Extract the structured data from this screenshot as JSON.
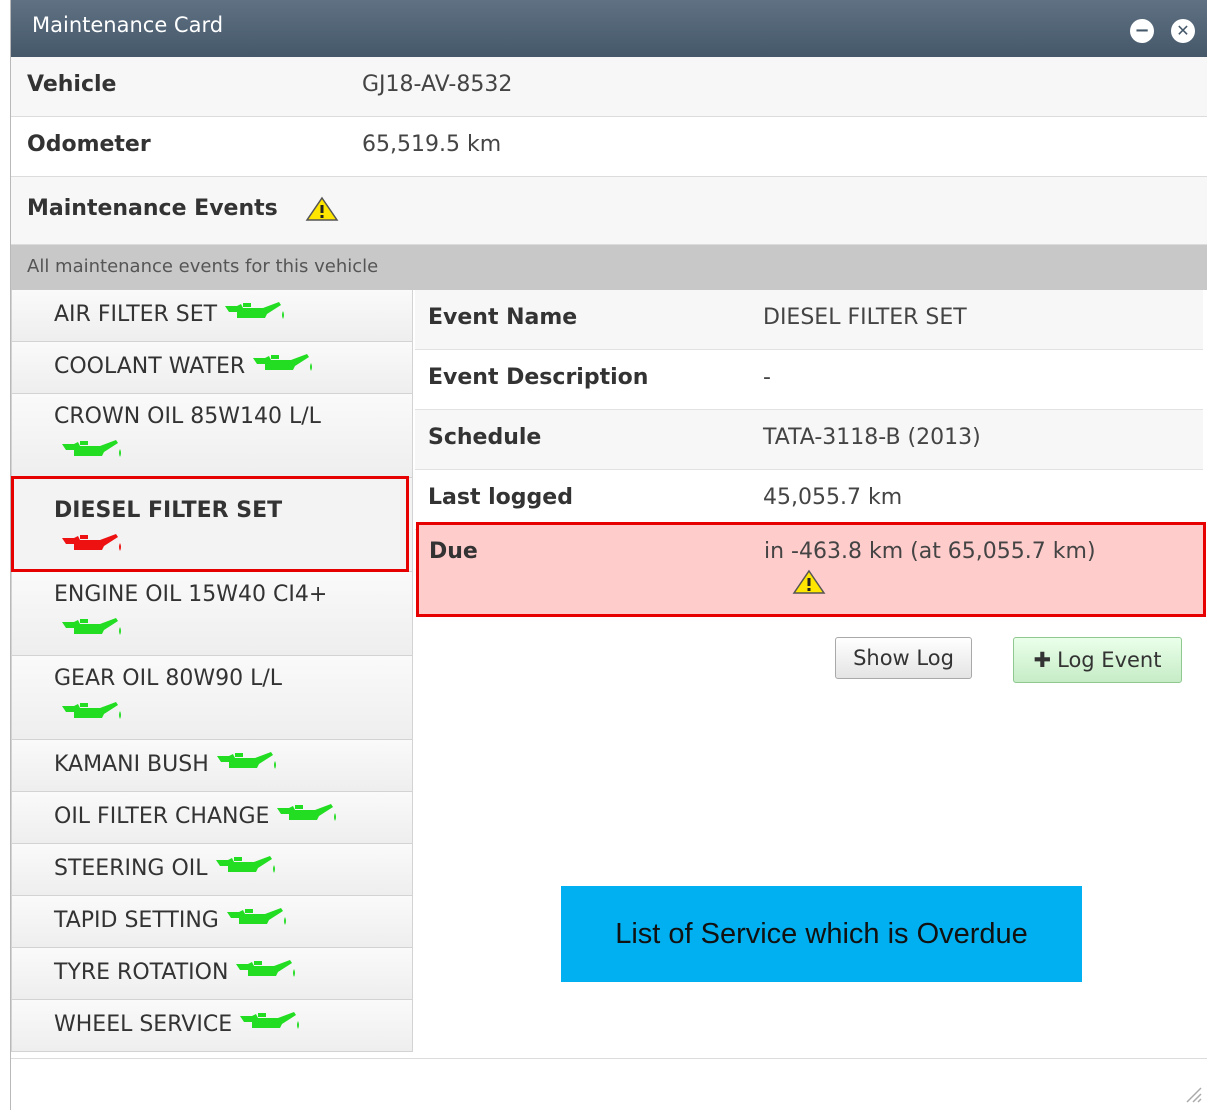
{
  "window": {
    "title": "Maintenance Card"
  },
  "info": {
    "vehicle_label": "Vehicle",
    "vehicle_value": "GJ18-AV-8532",
    "odometer_label": "Odometer",
    "odometer_value": "65,519.5 km",
    "events_label": "Maintenance Events"
  },
  "subheader": "All maintenance events for this vehicle",
  "events": [
    {
      "name": "AIR FILTER SET",
      "status": "ok"
    },
    {
      "name": "COOLANT WATER",
      "status": "ok"
    },
    {
      "name": "CROWN OIL 85W140 L/L",
      "status": "ok"
    },
    {
      "name": "DIESEL FILTER SET",
      "status": "overdue",
      "selected": true
    },
    {
      "name": "ENGINE OIL 15W40 CI4+",
      "status": "ok"
    },
    {
      "name": "GEAR OIL 80W90 L/L",
      "status": "ok"
    },
    {
      "name": "KAMANI BUSH",
      "status": "ok"
    },
    {
      "name": "OIL FILTER CHANGE",
      "status": "ok"
    },
    {
      "name": "STEERING OIL",
      "status": "ok"
    },
    {
      "name": "TAPID SETTING",
      "status": "ok"
    },
    {
      "name": "TYRE ROTATION",
      "status": "ok"
    },
    {
      "name": "WHEEL SERVICE",
      "status": "ok"
    }
  ],
  "detail": {
    "event_name_label": "Event Name",
    "event_name_value": "DIESEL FILTER SET",
    "description_label": "Event Description",
    "description_value": "-",
    "schedule_label": "Schedule",
    "schedule_value": "TATA-3118-B (2013)",
    "last_logged_label": "Last logged",
    "last_logged_value": "45,055.7 km",
    "due_label": "Due",
    "due_value": "in -463.8 km (at 65,055.7 km)"
  },
  "buttons": {
    "show_log": "Show Log",
    "log_event": "Log Event"
  },
  "callout": "List of Service which is Overdue",
  "colors": {
    "ok_icon": "#22dd22",
    "overdue_icon": "#ee1111",
    "highlight": "#e60000",
    "callout": "#00b0f0"
  },
  "icons": {
    "event_status": "oil-can-icon",
    "warning": "warning-icon"
  }
}
